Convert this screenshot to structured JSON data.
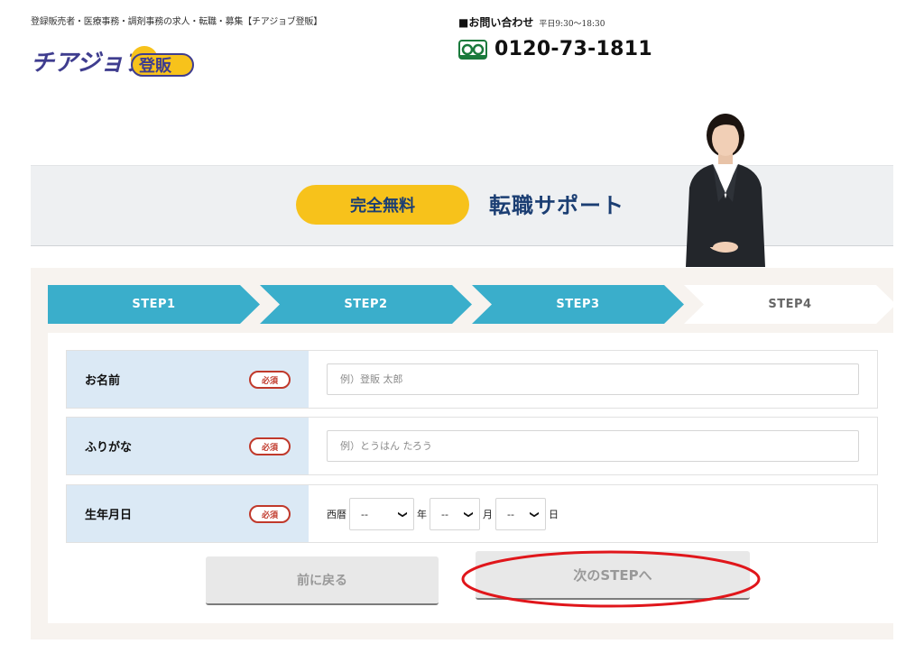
{
  "header": {
    "tagline": "登録販売者・医療事務・調剤事務の求人・転職・募集【チアジョブ登販】",
    "logo_text": "チアジョブ",
    "logo_badge": "登販",
    "contact_label": "■お問い合わせ",
    "contact_hours": "平日9:30〜18:30",
    "phone": "0120-73-1811"
  },
  "banner": {
    "badge": "完全無料",
    "title": "転職サポート"
  },
  "steps": [
    {
      "label": "STEP1"
    },
    {
      "label": "STEP2"
    },
    {
      "label": "STEP3"
    },
    {
      "label": "STEP4"
    }
  ],
  "form": {
    "required_label": "必須",
    "name": {
      "label": "お名前",
      "placeholder": "例）登販 太郎"
    },
    "kana": {
      "label": "ふりがな",
      "placeholder": "例）とうはん たろう"
    },
    "dob": {
      "label": "生年月日",
      "prefix": "西暦",
      "year_value": "--",
      "year_unit": "年",
      "month_value": "--",
      "month_unit": "月",
      "day_value": "--",
      "day_unit": "日"
    }
  },
  "buttons": {
    "back": "前に戻る",
    "next": "次のSTEPへ"
  },
  "colors": {
    "step_active": "#3aaecb",
    "step_inactive": "#ffffff",
    "badge_yellow": "#f7c21b",
    "navy": "#1b3e73",
    "annotation_red": "#e0161b"
  }
}
